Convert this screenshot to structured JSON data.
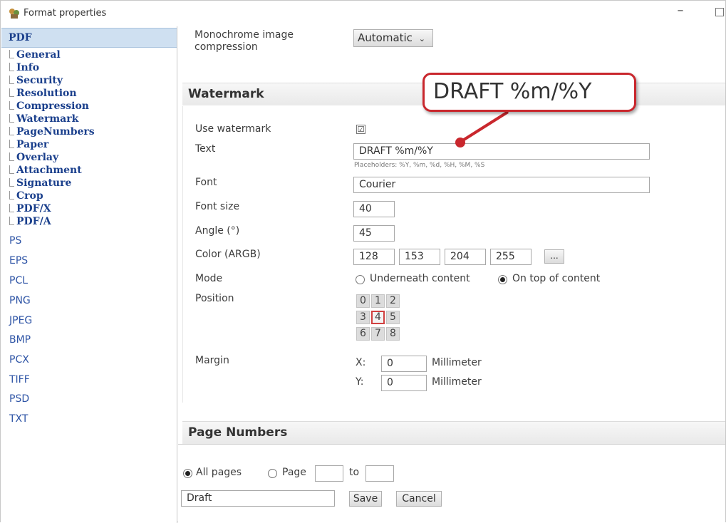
{
  "window": {
    "title": "Format properties",
    "minimize_glyph": "–"
  },
  "sidebar": {
    "selected": "PDF",
    "pdf_children": [
      "General",
      "Info",
      "Security",
      "Resolution",
      "Compression",
      "Watermark",
      "PageNumbers",
      "Paper",
      "Overlay",
      "Attachment",
      "Signature",
      "Crop",
      "PDF/X",
      "PDF/A"
    ],
    "formats": [
      "PS",
      "EPS",
      "PCL",
      "PNG",
      "JPEG",
      "BMP",
      "PCX",
      "TIFF",
      "PSD",
      "TXT"
    ]
  },
  "compression": {
    "label": "Monochrome image compression",
    "value": "Automatic",
    "arrow": "⌄"
  },
  "watermark": {
    "title": "Watermark",
    "use_label": "Use watermark",
    "use_checked": "☑",
    "text_label": "Text",
    "text_value": "DRAFT %m/%Y",
    "placeholder_hint": "Placeholders: %Y, %m, %d, %H, %M, %S",
    "font_label": "Font",
    "font_value": "Courier",
    "font_size_label": "Font size",
    "font_size_value": "40",
    "angle_label": "Angle (°)",
    "angle_value": "45",
    "color_label": "Color (ARGB)",
    "color_a": "128",
    "color_r": "153",
    "color_g": "204",
    "color_b": "255",
    "color_button": "...",
    "mode_label": "Mode",
    "mode_under": "Underneath content",
    "mode_top": "On top of content",
    "mode_selected": "On top of content",
    "position_label": "Position",
    "position_cells": [
      "0",
      "1",
      "2",
      "3",
      "4",
      "5",
      "6",
      "7",
      "8"
    ],
    "position_selected": 4,
    "margin_label": "Margin",
    "margin_x_label": "X:",
    "margin_x": "0",
    "margin_y_label": "Y:",
    "margin_y": "0",
    "unit": "Millimeter"
  },
  "page_numbers": {
    "title": "Page Numbers",
    "all_pages": "All pages",
    "page_label": "Page",
    "to_label": "to",
    "page_from": "",
    "page_to": "",
    "selected": "All pages"
  },
  "footer": {
    "preset_value": "Draft",
    "save": "Save",
    "cancel": "Cancel"
  },
  "callout": {
    "text": "DRAFT %m/%Y",
    "color": "#c9272d"
  },
  "colors": {
    "accent": "#1a3f8c",
    "selected_bg": "#cfe0f1",
    "highlight": "#c9272d"
  }
}
